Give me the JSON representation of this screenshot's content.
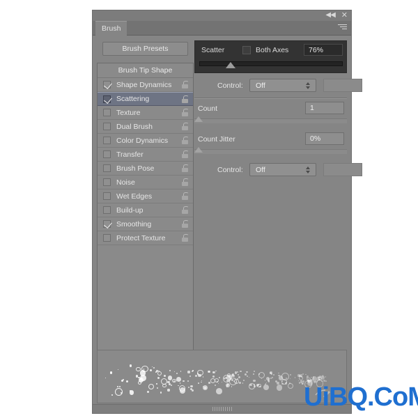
{
  "window": {
    "collapse_icon": "collapse-arrows",
    "close_icon": "close-x",
    "menu_icon": "panel-menu"
  },
  "tab": {
    "label": "Brush"
  },
  "left": {
    "presets_button": "Brush Presets",
    "tip_shape_header": "Brush Tip Shape",
    "options": [
      {
        "label": "Shape Dynamics",
        "checked": true,
        "selected": false
      },
      {
        "label": "Scattering",
        "checked": true,
        "selected": true
      },
      {
        "label": "Texture",
        "checked": false,
        "selected": false
      },
      {
        "label": "Dual Brush",
        "checked": false,
        "selected": false
      },
      {
        "label": "Color Dynamics",
        "checked": false,
        "selected": false
      },
      {
        "label": "Transfer",
        "checked": false,
        "selected": false
      },
      {
        "label": "Brush Pose",
        "checked": false,
        "selected": false
      },
      {
        "label": "Noise",
        "checked": false,
        "selected": false
      },
      {
        "label": "Wet Edges",
        "checked": false,
        "selected": false
      },
      {
        "label": "Build-up",
        "checked": false,
        "selected": false
      },
      {
        "label": "Smoothing",
        "checked": true,
        "selected": false
      },
      {
        "label": "Protect Texture",
        "checked": false,
        "selected": false
      }
    ]
  },
  "right": {
    "scatter": {
      "label": "Scatter",
      "both_axes_label": "Both Axes",
      "both_axes_checked": false,
      "value": "76%",
      "slider_percent": 20
    },
    "scatter_control": {
      "label": "Control:",
      "value": "Off"
    },
    "count": {
      "label": "Count",
      "value": "1",
      "slider_percent": 0
    },
    "count_jitter": {
      "label": "Count Jitter",
      "value": "0%",
      "slider_percent": 0
    },
    "jitter_control": {
      "label": "Control:",
      "value": "Off"
    }
  },
  "preview": {
    "brush_icon": "brush-tool-icon"
  },
  "watermark": {
    "text": "UiBQ.CoM",
    "color": "#1f6fd0"
  },
  "colors": {
    "panel_bg": "#858585",
    "dark_header": "#333333",
    "selection": "#6e7484",
    "text": "#e6e6e6"
  }
}
